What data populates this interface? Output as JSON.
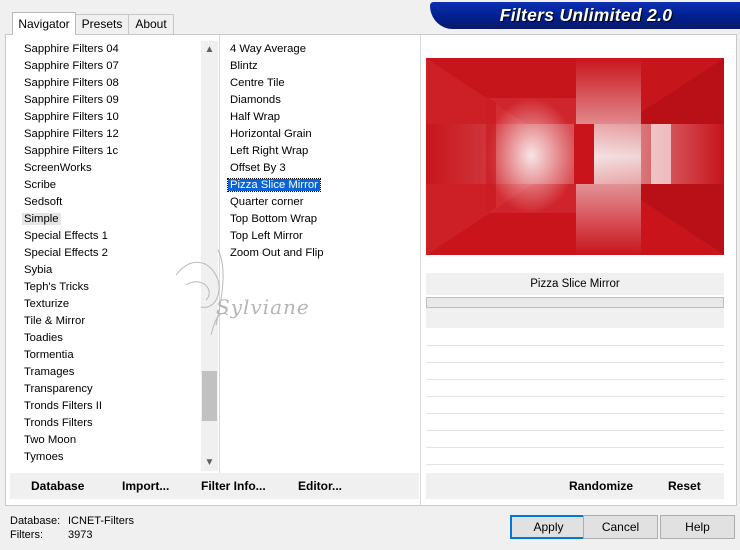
{
  "tabs": [
    {
      "label": "Navigator"
    },
    {
      "label": "Presets"
    },
    {
      "label": "About"
    }
  ],
  "title": "Filters Unlimited 2.0",
  "categories": {
    "items": [
      "Sapphire Filters 04",
      "Sapphire Filters 07",
      "Sapphire Filters 08",
      "Sapphire Filters 09",
      "Sapphire Filters 10",
      "Sapphire Filters 12",
      "Sapphire Filters 1c",
      "ScreenWorks",
      "Scribe",
      "Sedsoft",
      "Simple",
      "Special Effects 1",
      "Special Effects 2",
      "Sybia",
      "Teph's Tricks",
      "Texturize",
      "Tile & Mirror",
      "Toadies",
      "Tormentia",
      "Tramages",
      "Transparency",
      "Tronds Filters II",
      "Tronds Filters",
      "Two Moon",
      "Tymoes"
    ],
    "selected": "Simple"
  },
  "filters": {
    "items": [
      "4 Way Average",
      "Blintz",
      "Centre Tile",
      "Diamonds",
      "Half Wrap",
      "Horizontal Grain",
      "Left Right Wrap",
      "Offset By 3",
      "Pizza Slice Mirror",
      "Quarter corner",
      "Top Bottom Wrap",
      "Top Left Mirror",
      "Zoom Out and Flip"
    ],
    "selected": "Pizza Slice Mirror"
  },
  "watermark": "Sylviane",
  "filter_name": "Pizza Slice Mirror",
  "toolbar": {
    "database": "Database",
    "import": "Import...",
    "filter_info": "Filter Info...",
    "editor": "Editor...",
    "randomize": "Randomize",
    "reset": "Reset"
  },
  "status": {
    "database_label": "Database:",
    "database_value": "ICNET-Filters",
    "filters_label": "Filters:",
    "filters_value": "3973"
  },
  "buttons": {
    "apply": "Apply",
    "cancel": "Cancel",
    "help": "Help"
  },
  "colors": {
    "banner": "#0a2ba6",
    "selection": "#0a64d8",
    "preview_red": "#cc1f26"
  }
}
